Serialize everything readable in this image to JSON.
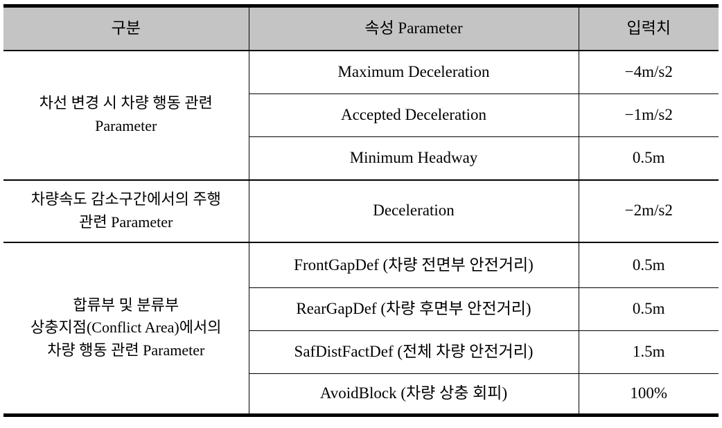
{
  "table": {
    "headers": {
      "group": "구분",
      "parameter": "속성 Parameter",
      "value": "입력치"
    },
    "groups": [
      {
        "label_line1": "차선 변경 시 차량 행동 관련",
        "label_line2": "Parameter",
        "rows": [
          {
            "parameter": "Maximum Deceleration",
            "value": "−4m/s2"
          },
          {
            "parameter": "Accepted Deceleration",
            "value": "−1m/s2"
          },
          {
            "parameter": "Minimum Headway",
            "value": "0.5m"
          }
        ]
      },
      {
        "label_line1": "차량속도 감소구간에서의 주행",
        "label_line2": "관련 Parameter",
        "rows": [
          {
            "parameter": "Deceleration",
            "value": "−2m/s2"
          }
        ]
      },
      {
        "label_line1": "합류부 및 분류부",
        "label_line2": "상충지점(Conflict Area)에서의",
        "label_line3": "차량 행동 관련 Parameter",
        "rows": [
          {
            "parameter": "FrontGapDef (차량 전면부 안전거리)",
            "value": "0.5m"
          },
          {
            "parameter": "RearGapDef (차량 후면부 안전거리)",
            "value": "0.5m"
          },
          {
            "parameter": "SafDistFactDef (전체 차량 안전거리)",
            "value": "1.5m"
          },
          {
            "parameter": "AvoidBlock (차량 상충 회피)",
            "value": "100%"
          }
        ]
      }
    ]
  },
  "style": {
    "header_background": "#c4c4c4",
    "border_color": "#000000",
    "text_color": "#000000",
    "page_background": "#ffffff"
  }
}
